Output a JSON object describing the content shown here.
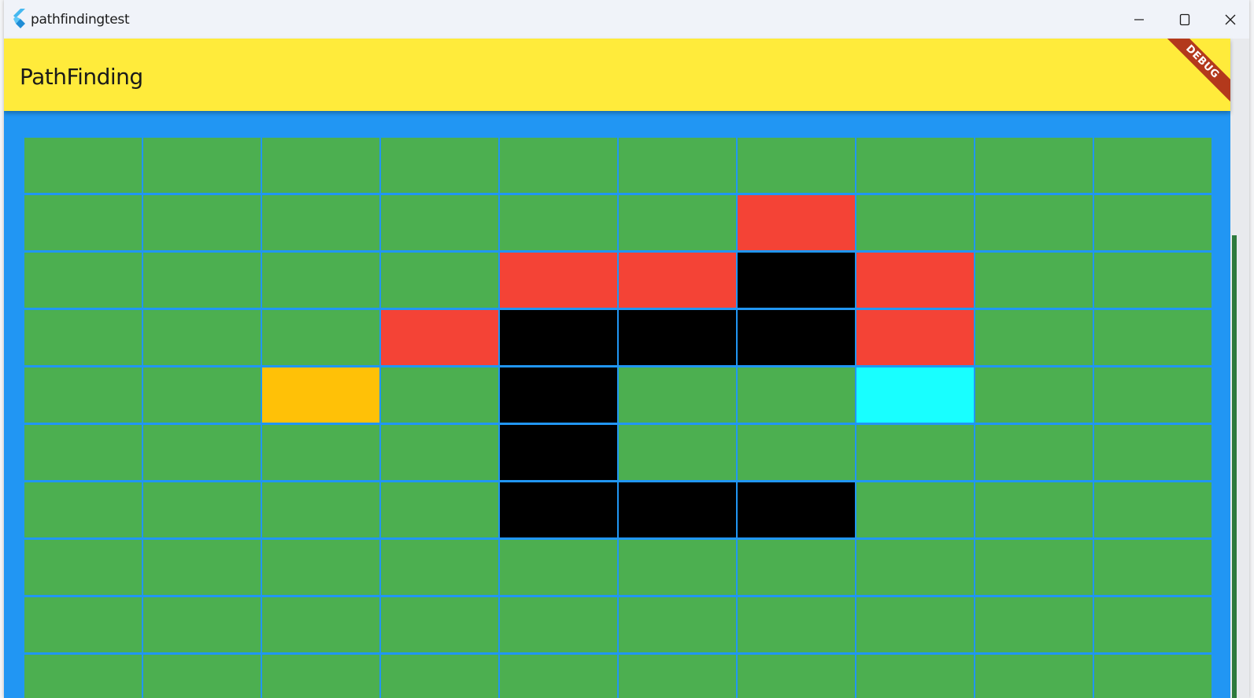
{
  "window": {
    "title": "pathfindingtest"
  },
  "appbar": {
    "title": "PathFinding",
    "debug_banner": "DEBUG"
  },
  "colors": {
    "empty": "#4caf50",
    "wall": "#000000",
    "visited": "#f44336",
    "start": "#ffc107",
    "end": "#18ffff",
    "background": "#2196f3",
    "appbar": "#ffeb3b"
  },
  "grid": {
    "columns": 10,
    "rows": [
      [
        "empty",
        "empty",
        "empty",
        "empty",
        "empty",
        "empty",
        "empty",
        "empty",
        "empty",
        "empty"
      ],
      [
        "empty",
        "empty",
        "empty",
        "empty",
        "empty",
        "empty",
        "visited",
        "empty",
        "empty",
        "empty"
      ],
      [
        "empty",
        "empty",
        "empty",
        "empty",
        "visited",
        "visited",
        "wall",
        "visited",
        "empty",
        "empty"
      ],
      [
        "empty",
        "empty",
        "empty",
        "visited",
        "wall",
        "wall",
        "wall",
        "visited",
        "empty",
        "empty"
      ],
      [
        "empty",
        "empty",
        "start",
        "empty",
        "wall",
        "empty",
        "empty",
        "end",
        "empty",
        "empty"
      ],
      [
        "empty",
        "empty",
        "empty",
        "empty",
        "wall",
        "empty",
        "empty",
        "empty",
        "empty",
        "empty"
      ],
      [
        "empty",
        "empty",
        "empty",
        "empty",
        "wall",
        "wall",
        "wall",
        "empty",
        "empty",
        "empty"
      ],
      [
        "empty",
        "empty",
        "empty",
        "empty",
        "empty",
        "empty",
        "empty",
        "empty",
        "empty",
        "empty"
      ],
      [
        "empty",
        "empty",
        "empty",
        "empty",
        "empty",
        "empty",
        "empty",
        "empty",
        "empty",
        "empty"
      ],
      [
        "empty",
        "empty",
        "empty",
        "empty",
        "empty",
        "empty",
        "empty",
        "empty",
        "empty",
        "empty"
      ]
    ]
  }
}
